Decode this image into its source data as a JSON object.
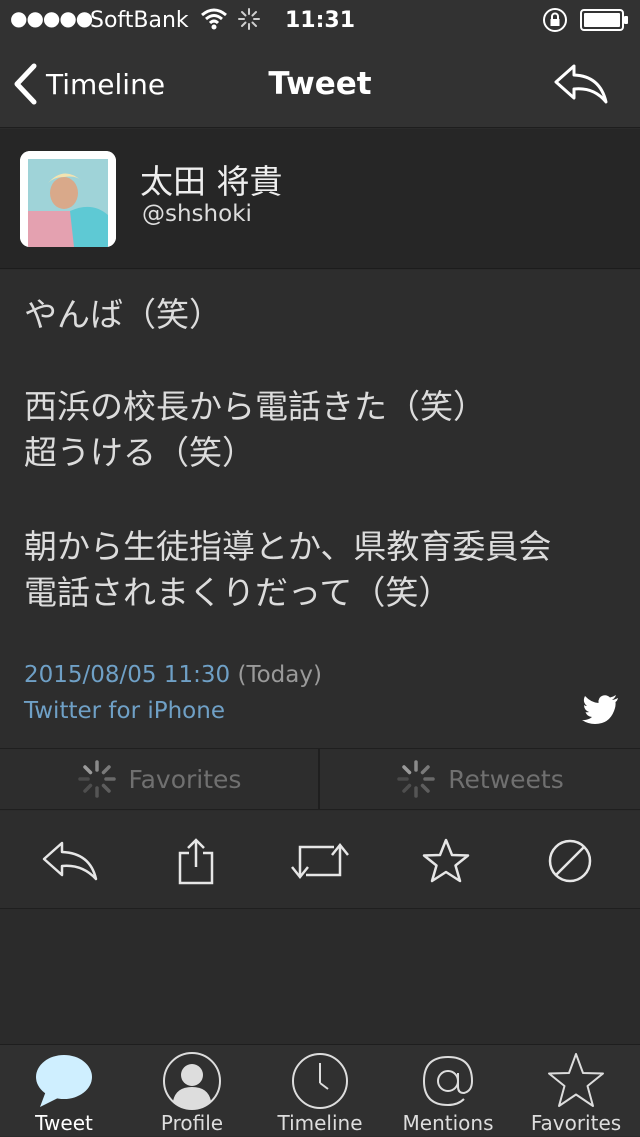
{
  "status_bar": {
    "signal": "●●●●●",
    "carrier": "SoftBank",
    "time": "11:31"
  },
  "nav": {
    "back_label": "Timeline",
    "title": "Tweet"
  },
  "user": {
    "name": "太田 将貴",
    "handle": "@shshoki"
  },
  "tweet": {
    "lines": [
      "やんば（笑）",
      "",
      "西浜の校長から電話きた（笑）",
      "超うける（笑）",
      "",
      "朝から生徒指導とか、県教育委員会",
      "電話されまくりだって（笑）"
    ],
    "date": "2015/08/05 11:30",
    "today": "(Today)",
    "source": "Twitter for iPhone"
  },
  "counts": {
    "favorites_label": "Favorites",
    "retweets_label": "Retweets"
  },
  "tabs": [
    {
      "label": "Tweet",
      "icon": "speech-bubble-icon",
      "active": true
    },
    {
      "label": "Profile",
      "icon": "person-icon",
      "active": false
    },
    {
      "label": "Timeline",
      "icon": "clock-icon",
      "active": false
    },
    {
      "label": "Mentions",
      "icon": "at-sign-icon",
      "active": false
    },
    {
      "label": "Favorites",
      "icon": "star-icon",
      "active": false
    }
  ],
  "colors": {
    "background": "#2b2b2b",
    "link": "#6fa0c6",
    "active_tab": "#cfefff"
  }
}
